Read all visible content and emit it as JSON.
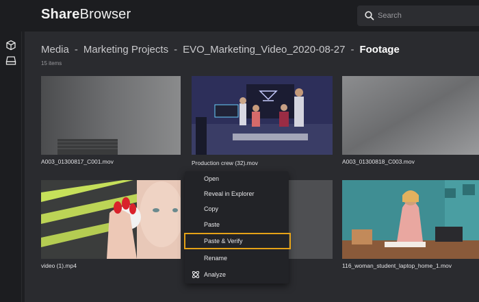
{
  "app": {
    "name_bold": "Share",
    "name_light": "Browser"
  },
  "search": {
    "placeholder": "Search"
  },
  "breadcrumb": {
    "items": [
      "Media",
      "Marketing Projects",
      "EVO_Marketing_Video_2020-08-27"
    ],
    "current": "Footage",
    "separator": "-"
  },
  "item_count": "15 items",
  "tiles": [
    {
      "caption": "A003_01300817_C001.mov"
    },
    {
      "caption": "Production crew (32).mov"
    },
    {
      "caption": "A003_01300818_C003.mov"
    },
    {
      "caption": "video (1).mp4"
    },
    {
      "caption": ""
    },
    {
      "caption": "116_woman_student_laptop_home_1.mov"
    }
  ],
  "context_menu": {
    "items": [
      "Open",
      "Reveal in Explorer",
      "Copy",
      "Paste",
      "Paste & Verify",
      "Rename",
      "Analyze"
    ],
    "highlighted": "Paste & Verify",
    "highlight_color": "#e6a317"
  },
  "left_rail": {
    "icons": [
      "cube-icon",
      "drive-icon"
    ]
  }
}
